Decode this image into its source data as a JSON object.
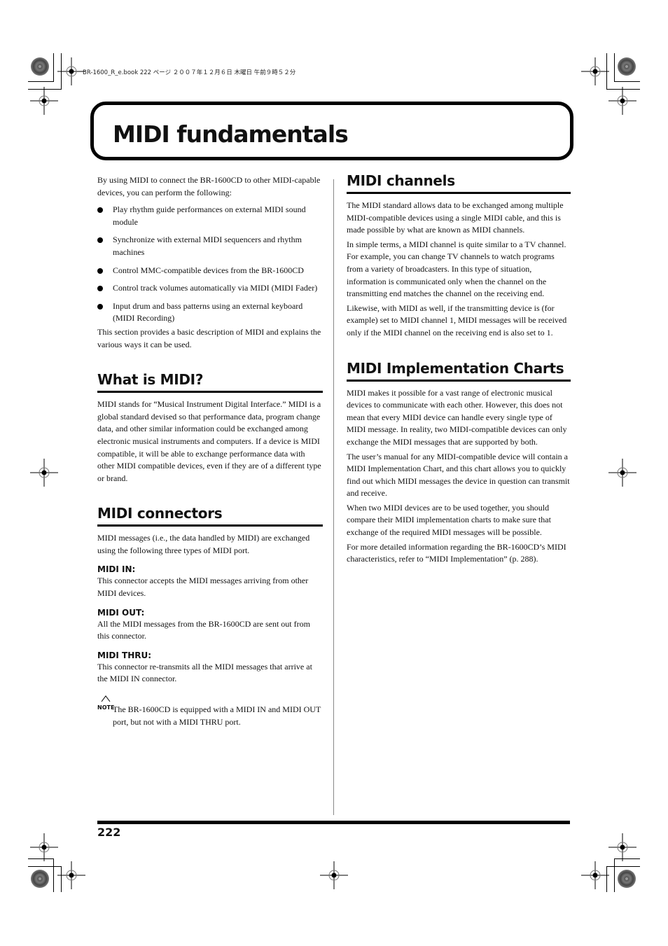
{
  "header_meta": "BR-1600_R_e.book  222 ページ  ２００７年１２月６日  木曜日  午前９時５２分",
  "title": "MIDI fundamentals",
  "left": {
    "intro": "By using MIDI to connect the BR-1600CD to other MIDI-capable devices, you can perform the following:",
    "bullets": [
      "Play rhythm guide performances on external MIDI sound module",
      "Synchronize with external MIDI sequencers and rhythm machines",
      "Control MMC-compatible devices from the BR-1600CD",
      "Control track volumes automatically via MIDI (MIDI Fader)",
      "Input drum and bass patterns using an external keyboard (MIDI Recording)"
    ],
    "outro": "This section provides a basic description of MIDI and explains the various ways it can be used.",
    "what_is_midi": {
      "heading": "What is MIDI?",
      "body": "MIDI stands for “Musical Instrument Digital Interface.” MIDI is a global standard devised so that performance data, program change data, and other similar information could be exchanged among electronic musical instruments and computers. If a device is MIDI compatible, it will be able to exchange performance data with other MIDI compatible devices, even if they are of a different type or brand."
    },
    "connectors": {
      "heading": "MIDI connectors",
      "intro": "MIDI messages (i.e., the data handled by MIDI) are exchanged using the following three types of MIDI port.",
      "ports": [
        {
          "name": "MIDI IN:",
          "desc": "This connector accepts the MIDI messages arriving from other MIDI devices."
        },
        {
          "name": "MIDI OUT:",
          "desc": "All the MIDI messages from the BR-1600CD are sent out from this connector."
        },
        {
          "name": "MIDI THRU:",
          "desc": "This connector re-transmits all the MIDI messages that arrive at the MIDI IN connector."
        }
      ],
      "note_label": "NOTE",
      "note": "The BR-1600CD is equipped with a MIDI IN and MIDI OUT port, but not with a MIDI THRU port."
    }
  },
  "right": {
    "channels": {
      "heading": "MIDI channels",
      "paragraphs": [
        "The MIDI standard allows data to be exchanged among multiple MIDI-compatible devices using a single MIDI cable, and this is made possible by what are known as MIDI channels.",
        "In simple terms, a MIDI channel is quite similar to a TV channel. For example, you can change TV channels to watch programs from a variety of broadcasters. In this type of situation, information is communicated only when the channel on the transmitting end matches the channel on the receiving end.",
        "Likewise, with MIDI as well, if the transmitting device is (for example) set to MIDI channel 1, MIDI messages will be received only if the MIDI channel on the receiving end is also set to 1."
      ]
    },
    "charts": {
      "heading": "MIDI Implementation Charts",
      "paragraphs": [
        "MIDI makes it possible for a vast range of electronic musical devices to communicate with each other. However, this does not mean that every MIDI device can handle every single type of MIDI message. In reality, two MIDI-compatible devices can only exchange the MIDI messages that are supported by both.",
        "The user’s manual for any MIDI-compatible device will contain a MIDI Implementation Chart, and this chart allows you to quickly find out which MIDI messages the device in question can transmit and receive.",
        "When two MIDI devices are to be used together, you should compare their MIDI implementation charts to make sure that exchange of the required MIDI messages will be possible.",
        "For more detailed information regarding the BR-1600CD’s MIDI characteristics, refer to “MIDI Implementation” (p. 288)."
      ]
    }
  },
  "page_number": "222"
}
